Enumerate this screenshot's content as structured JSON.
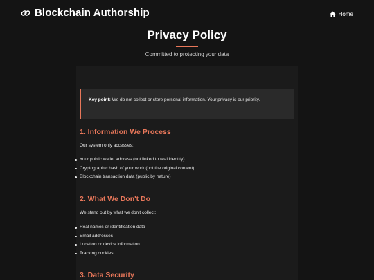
{
  "header": {
    "brand_title": "Blockchain Authorship",
    "brand_icon": "link-icon",
    "nav_home_label": "Home",
    "nav_home_icon": "home-icon"
  },
  "hero": {
    "title": "Privacy Policy",
    "subtitle": "Committed to protecting your data"
  },
  "callout": {
    "label": "Key point:",
    "text": " We do not collect or store personal information. Your privacy is our priority."
  },
  "sections": [
    {
      "title": "1. Information We Process",
      "intro": "Our system only accesses:",
      "items": [
        "Your public wallet address (not linked to real identity)",
        "Cryptographic hash of your work (not the original content)",
        "Blockchain transaction data (public by nature)"
      ]
    },
    {
      "title": "2. What We Don't Do",
      "intro": "We stand out by what we don't collect:",
      "items": [
        "Real names or identification data",
        "Email addresses",
        "Location or device information",
        "Tracking cookies"
      ]
    },
    {
      "title": "3. Data Security"
    }
  ],
  "colors": {
    "accent": "#e8775a",
    "background": "#141414",
    "panel": "#1b1b1b",
    "callout": "#2a2a2a"
  }
}
